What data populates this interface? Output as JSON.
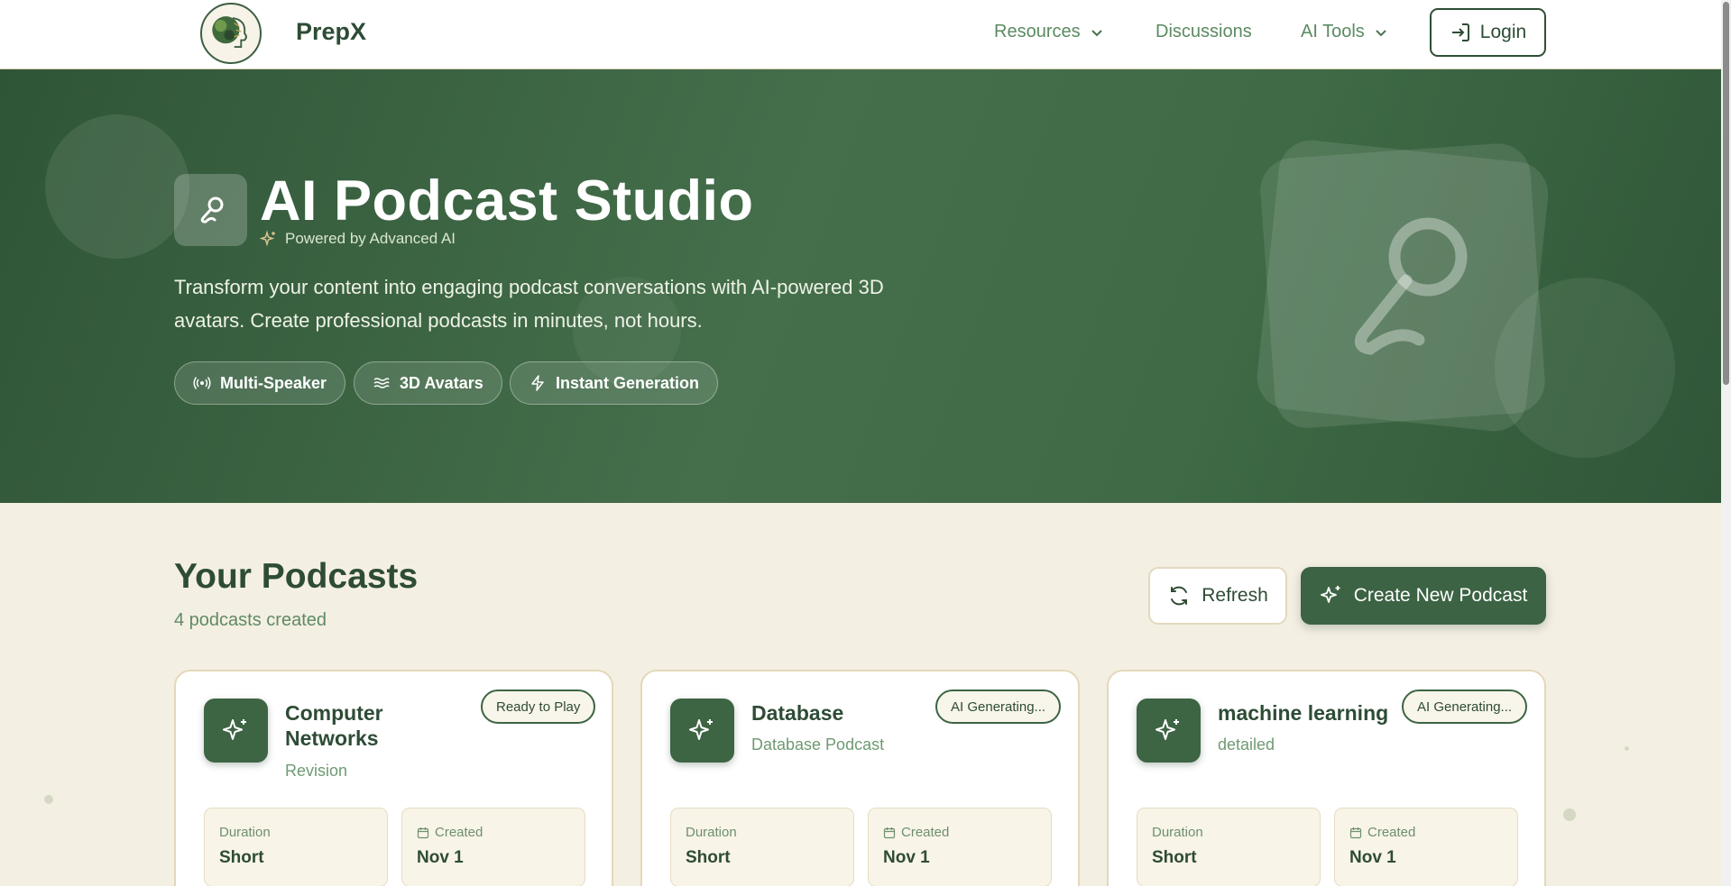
{
  "nav": {
    "brand": "PrepX",
    "links": [
      "Resources",
      "Discussions",
      "AI Tools"
    ],
    "login_label": "Login"
  },
  "hero": {
    "title": "AI Podcast Studio",
    "powered_by": "Powered by Advanced AI",
    "description": "Transform your content into engaging podcast conversations with AI-powered 3D avatars. Create professional podcasts in minutes, not hours.",
    "features": [
      {
        "label": "Multi-Speaker",
        "icon": "broadcast-icon"
      },
      {
        "label": "3D Avatars",
        "icon": "waves-icon"
      },
      {
        "label": "Instant Generation",
        "icon": "lightning-icon"
      }
    ]
  },
  "podcasts": {
    "title": "Your Podcasts",
    "count_text": "4 podcasts created",
    "refresh_label": "Refresh",
    "create_label": "Create New Podcast",
    "cards": [
      {
        "title": "Computer Networks",
        "subtitle": "Revision",
        "status": "Ready to Play",
        "duration_label": "Duration",
        "duration": "Short",
        "created_label": "Created",
        "created": "Nov 1"
      },
      {
        "title": "Database",
        "subtitle": "Database Podcast",
        "status": "AI Generating...",
        "duration_label": "Duration",
        "duration": "Short",
        "created_label": "Created",
        "created": "Nov 1"
      },
      {
        "title": "machine learning",
        "subtitle": "detailed",
        "status": "AI Generating...",
        "duration_label": "Duration",
        "duration": "Short",
        "created_label": "Created",
        "created": "Nov 1"
      }
    ]
  },
  "colors": {
    "primary": "#3c6343",
    "hero_bg": "#3f6a45",
    "page_bg": "#f4efe3",
    "accent_text": "#5b8a62"
  }
}
